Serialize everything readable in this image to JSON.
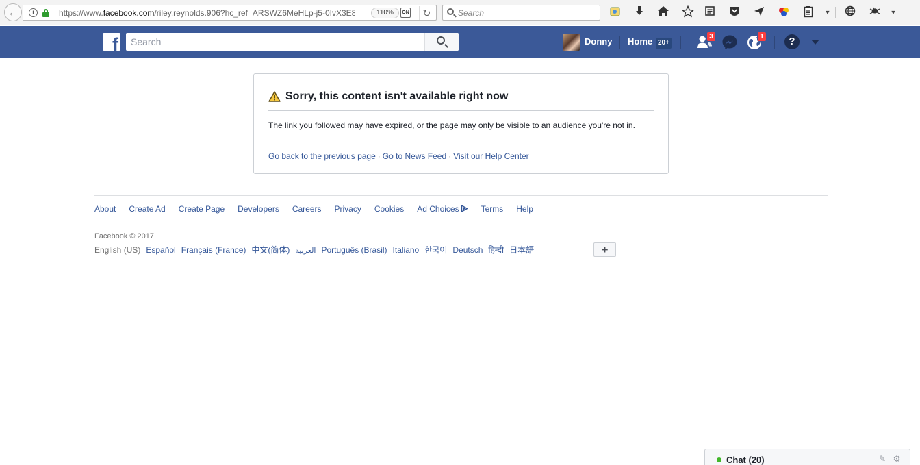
{
  "browser": {
    "url_prefix": "https://www.",
    "url_domain": "facebook.com",
    "url_rest": "/riley.reynolds.906?hc_ref=ARSWZ6MeHLp-j5-0IvX3E8",
    "zoom": "110%",
    "search_placeholder": "Search",
    "ext_badge": "ON",
    "icons": [
      "extension-icon",
      "download-icon",
      "home-icon",
      "bookmark-star-icon",
      "reader-icon",
      "pocket-icon",
      "send-icon",
      "colors-icon",
      "clipboard-icon",
      "globe-icon",
      "bug-icon",
      "menu-icon"
    ]
  },
  "fb": {
    "search_placeholder": "Search",
    "user_name": "Donny",
    "home_label": "Home",
    "home_count": "20+",
    "friend_requests_count": "3",
    "notifications_count": "1",
    "help_label": "?",
    "brand_color": "#3b5998"
  },
  "error": {
    "title": "Sorry, this content isn't available right now",
    "body": "The link you followed may have expired, or the page may only be visible to an audience you're not in.",
    "links": [
      "Go back to the previous page",
      "Go to News Feed",
      "Visit our Help Center"
    ]
  },
  "footer": {
    "links": [
      "About",
      "Create Ad",
      "Create Page",
      "Developers",
      "Careers",
      "Privacy",
      "Cookies",
      "Ad Choices",
      "Terms",
      "Help"
    ],
    "copyright": "Facebook © 2017",
    "current_language": "English (US)",
    "languages": [
      "Español",
      "Français (France)",
      "中文(简体)",
      "العربية",
      "Português (Brasil)",
      "Italiano",
      "한국어",
      "Deutsch",
      "हिन्दी",
      "日本語"
    ],
    "more_label": "+"
  },
  "chat": {
    "label": "Chat (20)"
  }
}
